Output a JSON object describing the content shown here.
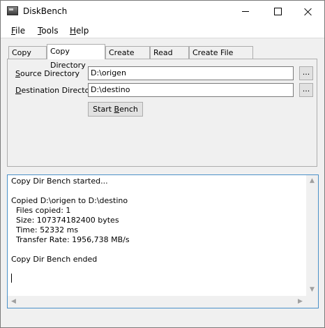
{
  "window": {
    "title": "DiskBench"
  },
  "menu": [
    {
      "mnemonic": "F",
      "rest": "ile"
    },
    {
      "mnemonic": "T",
      "rest": "ools"
    },
    {
      "mnemonic": "H",
      "rest": "elp"
    }
  ],
  "tabs": [
    "Copy File",
    "Copy Directory",
    "Create File",
    "Read File",
    "Create File Batch"
  ],
  "active_tab": "Copy Directory",
  "form": {
    "source": {
      "mnemonic": "S",
      "rest": "ource Directory",
      "value": "D:\\origen",
      "browse_label": "..."
    },
    "destination": {
      "mnemonic": "D",
      "rest": "estination Directory",
      "value": "D:\\destino",
      "browse_label": "..."
    },
    "start": {
      "pre": "Start ",
      "mnemonic": "B",
      "post": "ench"
    }
  },
  "log": [
    "Copy Dir Bench started...",
    "",
    "Copied D:\\origen to D:\\destino",
    "  Files copied: 1",
    "  Size: 107374182400 bytes",
    "  Time: 52332 ms",
    "  Transfer Rate: 1956,738 MB/s",
    "",
    "Copy Dir Bench ended"
  ],
  "icons": {
    "app": "drive-icon",
    "minimize": "minimize-icon",
    "maximize": "maximize-icon",
    "close": "close-icon"
  },
  "colors": {
    "focus_border": "#4a90c8"
  }
}
